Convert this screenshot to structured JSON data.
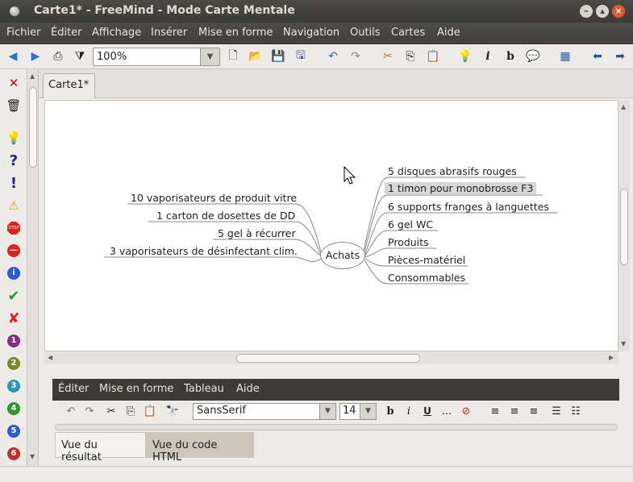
{
  "window": {
    "title": "Carte1* - FreeMind - Mode Carte Mentale"
  },
  "menu": [
    "Fichier",
    "Éditer",
    "Affichage",
    "Insérer",
    "Mise en forme",
    "Navigation",
    "Outils",
    "Cartes",
    "Aide"
  ],
  "toolbar": {
    "zoom_value": "100%"
  },
  "tabs": {
    "active": "Carte1*"
  },
  "map": {
    "central": "Achats",
    "right_nodes": [
      "5 disques abrasifs rouges",
      "1 timon pour monobrosse F3",
      "6 supports franges à languettes",
      "6 gel WC",
      "Produits",
      "Pièces-matériel",
      "Consommables"
    ],
    "left_nodes": [
      "10 vaporisateurs de produit vitre",
      "1 carton de dosettes de DD",
      "5 gel à récurrer",
      "3 vaporisateurs de désinfectant clim."
    ],
    "selected": "1 timon pour monobrosse F3"
  },
  "editor": {
    "menu": [
      "Éditer",
      "Mise en forme",
      "Tableau",
      "Aide"
    ],
    "font": "SansSerif",
    "size": "14",
    "ellipsis": "...",
    "view_tabs": [
      "Vue du résultat",
      "Vue du code HTML"
    ]
  },
  "colors": {
    "accent": "#e05a28",
    "selection": "#d6d6d6",
    "edge": "#888888"
  }
}
